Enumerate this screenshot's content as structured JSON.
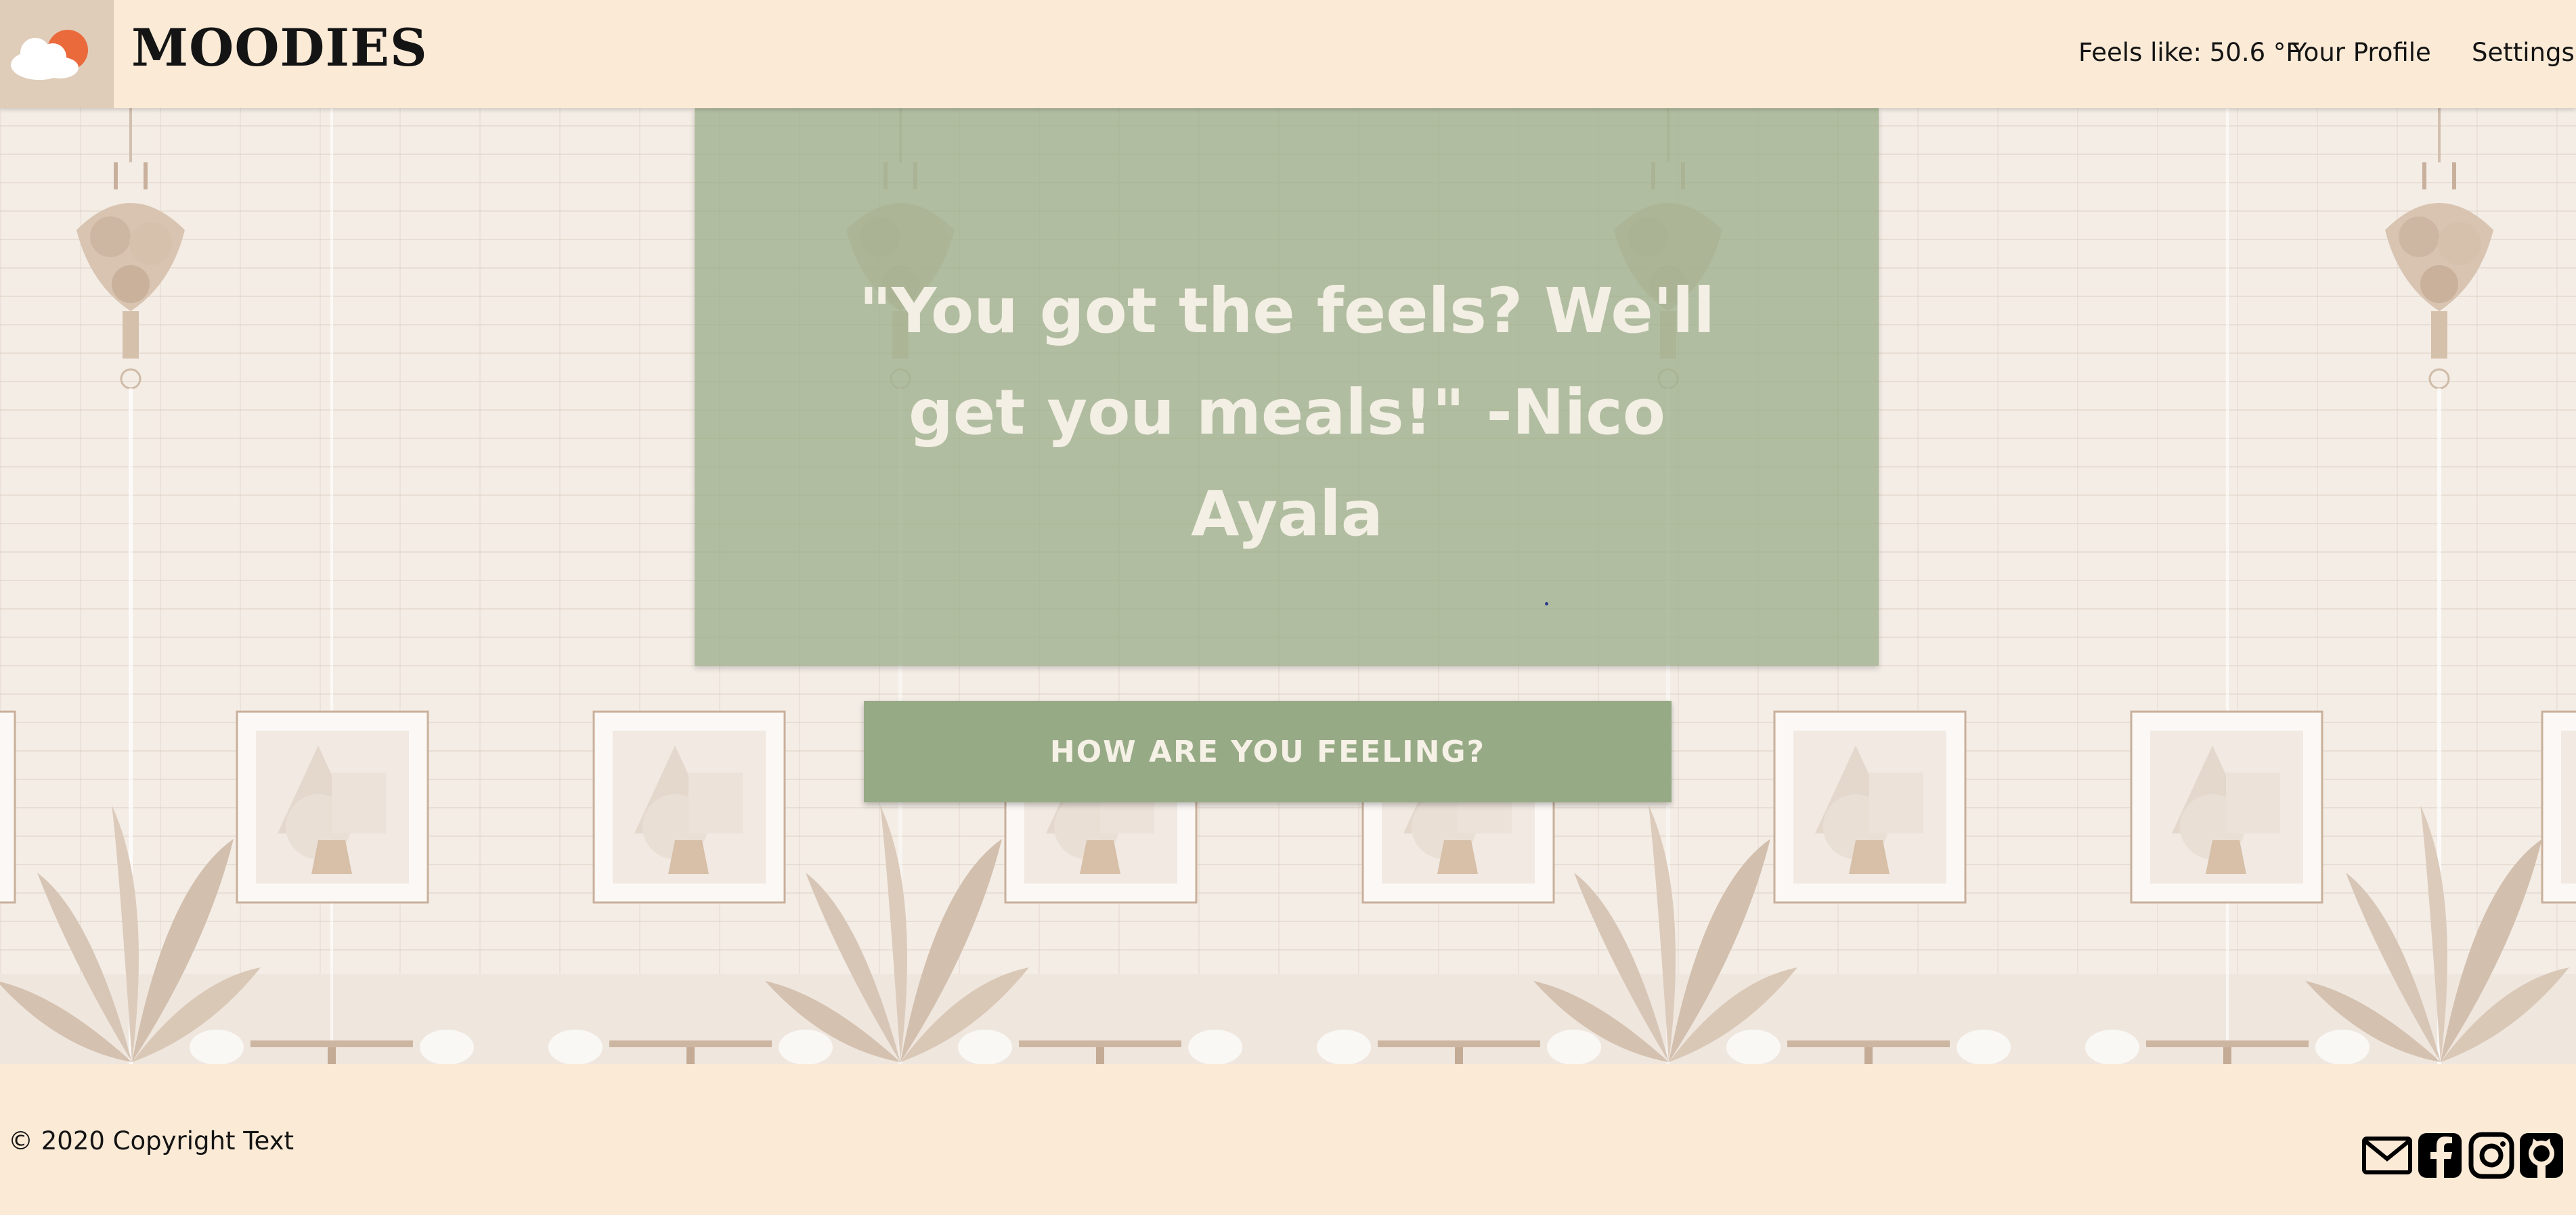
{
  "header": {
    "brand": "MOODIES",
    "logo_icon": "cloud-sun-icon",
    "nav": {
      "feels_like": "Feels like: 50.6 °F",
      "profile": "Your Profile",
      "settings": "Settings"
    }
  },
  "main": {
    "quote": "\"You got the feels? We'll get you meals!\" -Nico Ayala",
    "cta_label": "HOW ARE YOU FEELING?"
  },
  "footer": {
    "copyright": "© 2020 Copyright Text",
    "social_icons": [
      "mail-icon",
      "facebook-icon",
      "instagram-icon",
      "github-icon"
    ]
  },
  "colors": {
    "background": "#faead6",
    "accent_green": "#97aa86",
    "logo_box": "#dfcdb9",
    "text": "#141414"
  }
}
